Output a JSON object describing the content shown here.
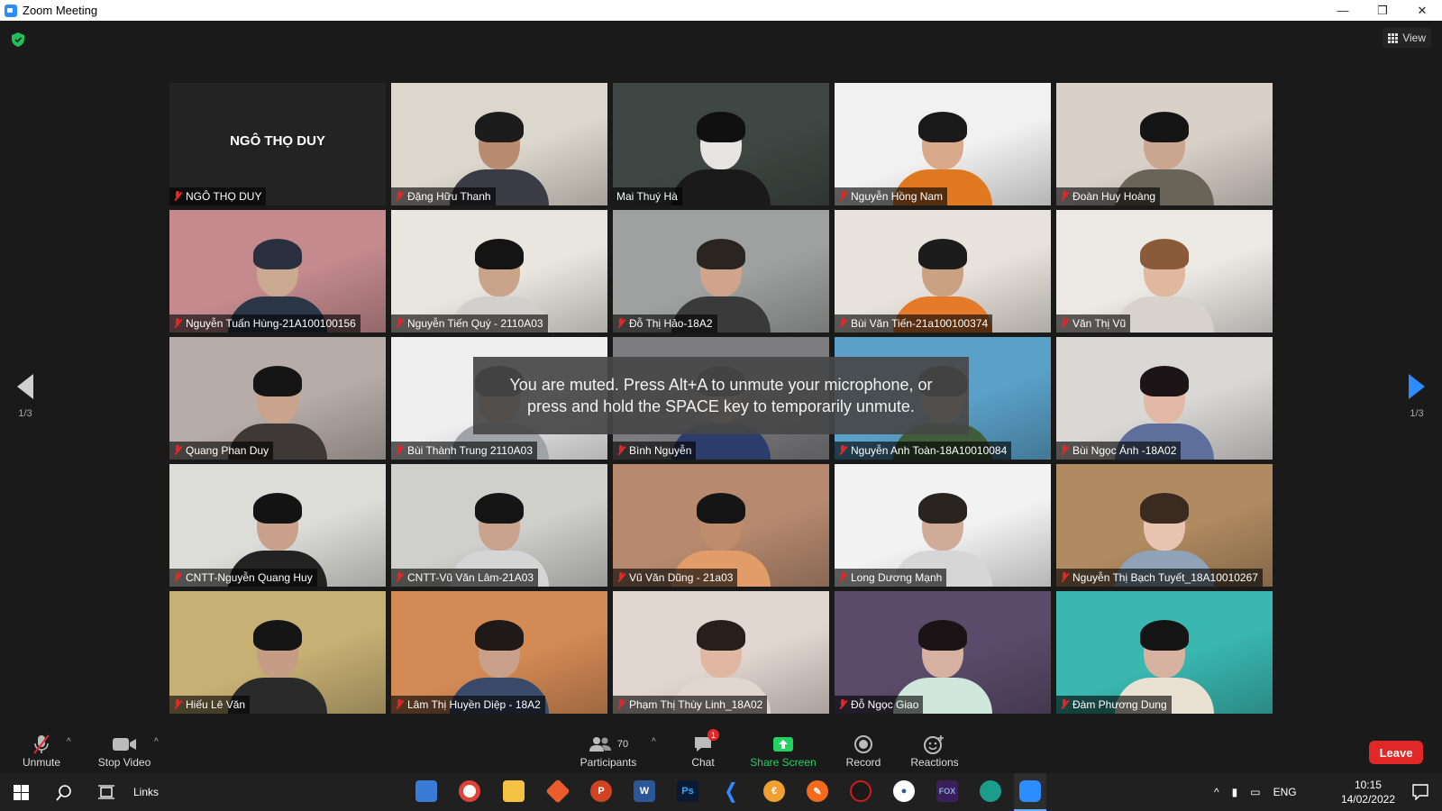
{
  "window": {
    "title": "Zoom Meeting"
  },
  "header": {
    "view_label": "View"
  },
  "pager": {
    "left": "1/3",
    "right": "1/3"
  },
  "toast": {
    "line1": "You are muted. Press Alt+A to unmute your microphone, or",
    "line2": "press and hold the SPACE key to temporarily unmute."
  },
  "tiles": [
    {
      "name": "NGÔ THỌ DUY",
      "big_name": "NGÔ THỌ DUY",
      "video": false,
      "muted": true
    },
    {
      "name": "Đặng Hữu Thanh",
      "muted": true,
      "bg": "#dcd7cc",
      "hair": "#1c1c1c",
      "skin": "#b88a70",
      "cloth": "#3b3b45"
    },
    {
      "name": "Mai Thuý Hà",
      "muted": false,
      "active": true,
      "bg": "#3e4743",
      "hair": "#101010",
      "skin": "#e6e4e2",
      "cloth": "#1a1a1a"
    },
    {
      "name": "Nguyễn Hồng Nam",
      "muted": true,
      "bg": "#f1f1f1",
      "hair": "#1a1a1a",
      "skin": "#d8a98a",
      "cloth": "#e07820"
    },
    {
      "name": "Đoàn Huy Hoàng",
      "muted": true,
      "bg": "#d9d0c8",
      "hair": "#151515",
      "skin": "#caa58f",
      "cloth": "#6a6458"
    },
    {
      "name": "Nguyễn Tuấn Hùng-21A100100156",
      "muted": true,
      "bg": "#c48a8e",
      "hair": "#2a3040",
      "skin": "#caa990",
      "cloth": "#2b3648"
    },
    {
      "name": "Nguyễn Tiến Quý - 2110A03",
      "muted": true,
      "bg": "#e9e5df",
      "hair": "#141414",
      "skin": "#caa48a",
      "cloth": "#d2d0cc"
    },
    {
      "name": "Đỗ Thị Hảo-18A2",
      "muted": true,
      "bg": "#9fa1a0",
      "hair": "#2a2520",
      "skin": "#d0a48c",
      "cloth": "#3a3a3a"
    },
    {
      "name": "Bùi Văn Tiến-21a100100374",
      "muted": true,
      "bg": "#e8e2dc",
      "hair": "#1c1c1c",
      "skin": "#cba184",
      "cloth": "#e57a2a"
    },
    {
      "name": "Văn Thị Vũ",
      "muted": true,
      "bg": "#ece9e4",
      "hair": "#8a5a3a",
      "skin": "#e0b8a0",
      "cloth": "#d8d2cc"
    },
    {
      "name": "Quang Phan Duy",
      "muted": true,
      "bg": "#b7aca7",
      "hair": "#151515",
      "skin": "#c9a38c",
      "cloth": "#3e3836"
    },
    {
      "name": "Bùi Thành Trung 2110A03",
      "muted": true,
      "bg": "#efefef",
      "hair": "#151515",
      "skin": "#c7a08a",
      "cloth": "#9fa3a8"
    },
    {
      "name": "Bình Nguyễn",
      "muted": true,
      "bg": "#7d7c7f",
      "hair": "#1d1d1d",
      "skin": "#b8957c",
      "cloth": "#2d3d6b"
    },
    {
      "name": "Nguyễn Anh Toàn-18A10010084",
      "muted": true,
      "bg": "#5aa0c8",
      "hair": "#151515",
      "skin": "#c6a08a",
      "cloth": "#3f5d3a"
    },
    {
      "name": "Bùi Ngọc Ánh -18A02",
      "muted": true,
      "bg": "#dad8d5",
      "hair": "#1c1416",
      "skin": "#e0b8a5",
      "cloth": "#5d6f9a"
    },
    {
      "name": "CNTT-Nguyễn Quang Huy",
      "muted": true,
      "bg": "#dcdcd9",
      "hair": "#131313",
      "skin": "#c9a08a",
      "cloth": "#222"
    },
    {
      "name": "CNTT-Vũ Văn Lâm-21A03",
      "muted": true,
      "bg": "#cfcfcb",
      "hair": "#151515",
      "skin": "#c9a38e",
      "cloth": "#d5d5d5"
    },
    {
      "name": "Vũ Văn Dũng - 21a03",
      "muted": true,
      "bg": "#b78a6f",
      "hair": "#151515",
      "skin": "#c08d6c",
      "cloth": "#e29c6a"
    },
    {
      "name": "Long Dương Mạnh",
      "muted": true,
      "bg": "#f2f2f2",
      "hair": "#2a2420",
      "skin": "#d0ac98",
      "cloth": "#d6d6d6"
    },
    {
      "name": "Nguyễn Thị Bạch Tuyết_18A10010267",
      "muted": true,
      "bg": "#b08a60",
      "hair": "#3a2a20",
      "skin": "#e7c3b0",
      "cloth": "#8fa2b8"
    },
    {
      "name": "Hiếu Lê Văn",
      "muted": true,
      "bg": "#c7b074",
      "hair": "#151515",
      "skin": "#c59c84",
      "cloth": "#2a2a2a"
    },
    {
      "name": "Lâm Thị Huyền Diệp - 18A2",
      "muted": true,
      "bg": "#d48a55",
      "hair": "#1f1a18",
      "skin": "#c9a08a",
      "cloth": "#3a4a6a"
    },
    {
      "name": "Phạm Thị Thùy Linh_18A02",
      "muted": true,
      "bg": "#e2d6d0",
      "hair": "#2a1e1a",
      "skin": "#e0b7a2",
      "cloth": "#e2d6d0"
    },
    {
      "name": "Đỗ Ngọc Giao",
      "muted": true,
      "bg": "#5b4b6a",
      "hair": "#1a1416",
      "skin": "#d6b0a0",
      "cloth": "#cfe6dc"
    },
    {
      "name": "Đàm Phương Dung",
      "muted": true,
      "bg": "#39b7b0",
      "hair": "#151515",
      "skin": "#d8b2a0",
      "cloth": "#e8e0d0"
    }
  ],
  "toolbar": {
    "unmute": "Unmute",
    "stop_video": "Stop Video",
    "participants": "Participants",
    "participants_count": "70",
    "chat": "Chat",
    "chat_badge": "1",
    "share": "Share Screen",
    "record": "Record",
    "reactions": "Reactions",
    "leave": "Leave"
  },
  "taskbar": {
    "links": "Links",
    "lang": "ENG",
    "time": "10:15",
    "date": "14/02/2022"
  }
}
